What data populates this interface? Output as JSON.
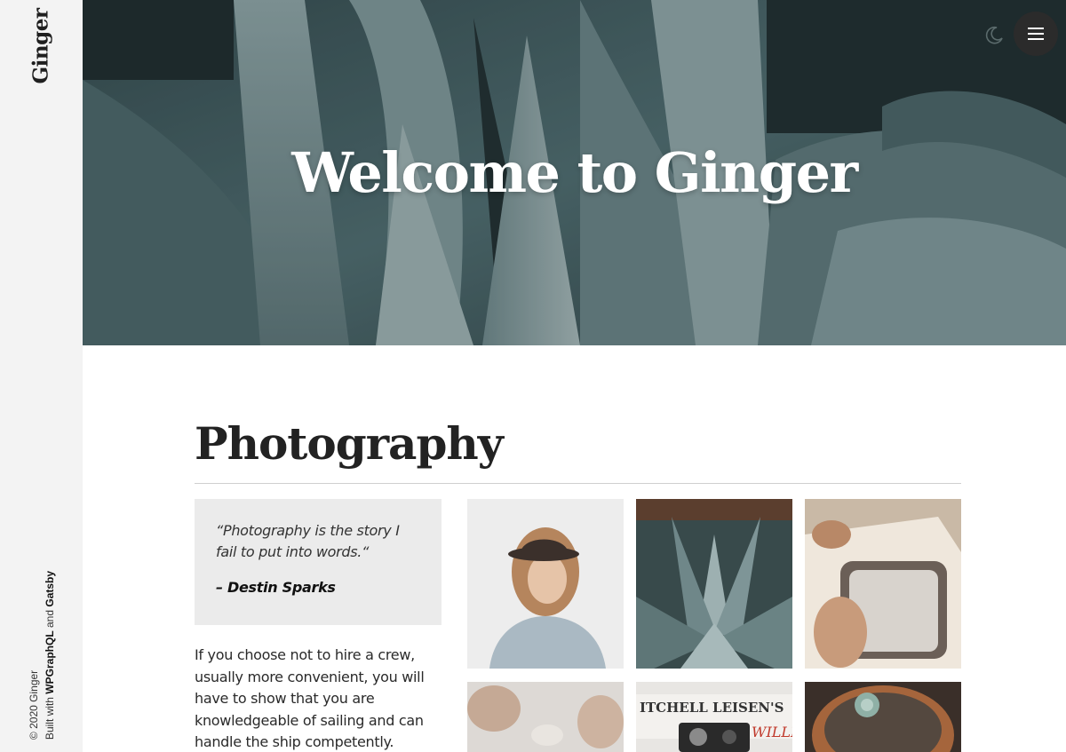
{
  "sidebar": {
    "brand": "Ginger",
    "copyright": "© 2020 Ginger",
    "built_with_prefix": "Built with",
    "tech_1": "WPGraphQL",
    "connector": "and",
    "tech_2": "Gatsby"
  },
  "hero": {
    "title": "Welcome to Ginger"
  },
  "header": {
    "theme_toggle_icon": "moon-icon",
    "menu_icon": "hamburger-icon"
  },
  "section": {
    "title": "Photography",
    "quote": "“Photography is the story I fail to put into words.“",
    "quote_author": "– Destin Sparks",
    "body": "If you choose not to hire a crew, usually more convenient, you will have to show that you are knowledgeable of sailing and can handle the ship competently."
  },
  "gallery": {
    "tiles": [
      "woman-hat-photo",
      "agave-photo",
      "car-window-photo",
      "dried-flowers-photo",
      "camera-sign-photo",
      "succulent-pot-photo"
    ]
  },
  "colors": {
    "sidebar_bg": "#f3f3f3",
    "hero_tint": "#3d5659",
    "quote_bg": "#ebebeb",
    "menu_btn": "#2b2b2b"
  }
}
